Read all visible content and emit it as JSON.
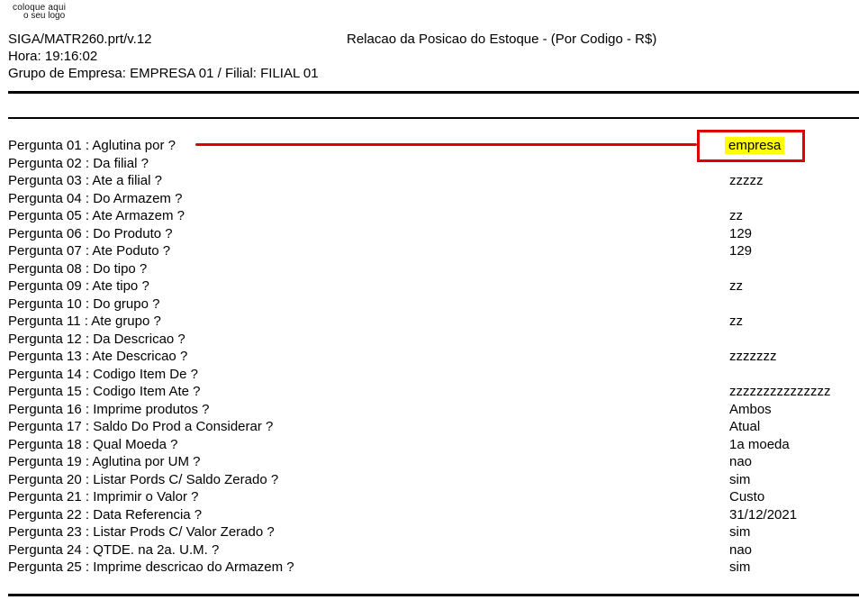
{
  "logo": {
    "line1": "coloque aqui",
    "line2": "o seu logo"
  },
  "header": {
    "program": "SIGA/MATR260.prt/v.12",
    "title": "Relacao da Posicao do Estoque - (Por Codigo - R$)",
    "time": "Hora: 19:16:02",
    "company": "Grupo de Empresa: EMPRESA 01 / Filial: FILIAL 01"
  },
  "parameters": [
    {
      "question": "Pergunta 01 : Aglutina por ?",
      "answer": ""
    },
    {
      "question": "Pergunta 02 : Da filial ?",
      "answer": ""
    },
    {
      "question": "Pergunta 03 : Ate a filial ?",
      "answer": "zzzzz"
    },
    {
      "question": "Pergunta 04 : Do Armazem ?",
      "answer": ""
    },
    {
      "question": "Pergunta 05 : Ate Armazem ?",
      "answer": "zz"
    },
    {
      "question": "Pergunta 06 : Do Produto ?",
      "answer": "129"
    },
    {
      "question": "Pergunta 07 : Ate Poduto ?",
      "answer": "129"
    },
    {
      "question": "Pergunta 08 : Do tipo ?",
      "answer": ""
    },
    {
      "question": "Pergunta 09 : Ate tipo ?",
      "answer": "zz"
    },
    {
      "question": "Pergunta 10 : Do grupo ?",
      "answer": ""
    },
    {
      "question": "Pergunta 11 : Ate grupo ?",
      "answer": "zz"
    },
    {
      "question": "Pergunta 12 : Da Descricao ?",
      "answer": ""
    },
    {
      "question": "Pergunta 13 : Ate Descricao ?",
      "answer": "zzzzzzz"
    },
    {
      "question": "Pergunta 14 : Codigo Item De ?",
      "answer": ""
    },
    {
      "question": "Pergunta 15 : Codigo Item Ate ?",
      "answer": "zzzzzzzzzzzzzzz"
    },
    {
      "question": "Pergunta 16 : Imprime produtos ?",
      "answer": "Ambos"
    },
    {
      "question": "Pergunta 17 : Saldo Do Prod a Considerar ?",
      "answer": "Atual"
    },
    {
      "question": "Pergunta 18 : Qual Moeda ?",
      "answer": "1a moeda"
    },
    {
      "question": "Pergunta 19 : Aglutina por UM ?",
      "answer": "nao"
    },
    {
      "question": "Pergunta 20 : Listar Pords C/ Saldo Zerado ?",
      "answer": "sim"
    },
    {
      "question": "Pergunta 21 : Imprimir o Valor ?",
      "answer": "Custo"
    },
    {
      "question": "Pergunta 22 : Data Referencia ?",
      "answer": "31/12/2021"
    },
    {
      "question": "Pergunta 23 : Listar Prods C/ Valor Zerado ?",
      "answer": "sim"
    },
    {
      "question": "Pergunta 24 : QTDE. na 2a. U.M. ?",
      "answer": "nao"
    },
    {
      "question": "Pergunta 25 : Imprime descricao do Armazem ?",
      "answer": "sim"
    }
  ],
  "highlight": {
    "answer": "empresa",
    "color_box": "#e00000",
    "color_fill": "#ffff00"
  }
}
